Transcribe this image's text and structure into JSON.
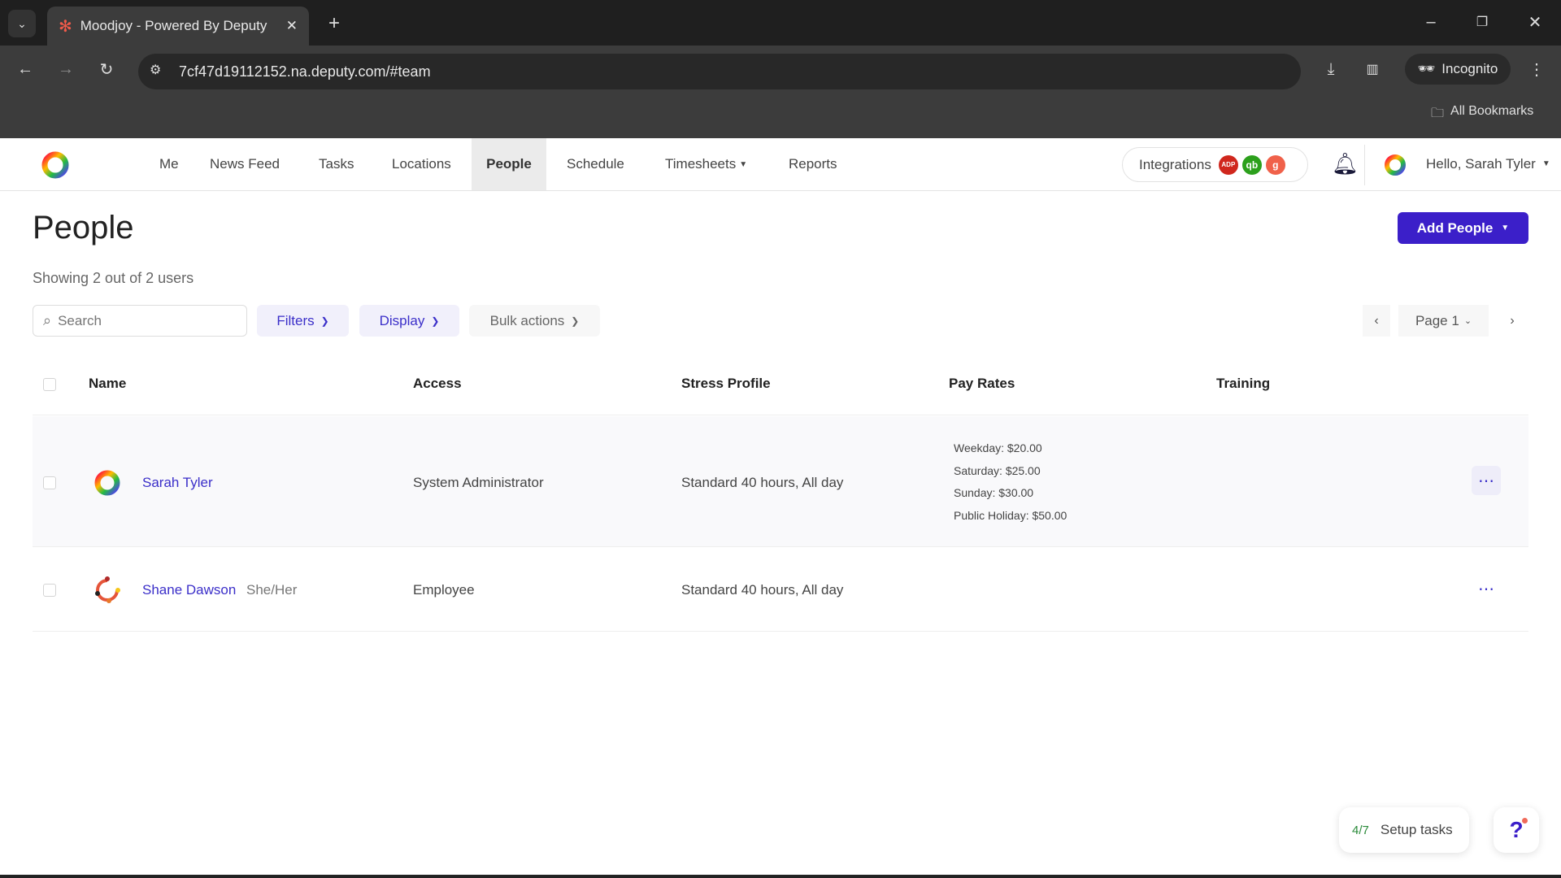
{
  "browser": {
    "tab_title": "Moodjoy - Powered By Deputy",
    "url": "7cf47d19112152.na.deputy.com/#team",
    "incognito_label": "Incognito",
    "bookmarks_label": "All Bookmarks"
  },
  "nav": {
    "items": [
      "Me",
      "News Feed",
      "Tasks",
      "Locations",
      "People",
      "Schedule",
      "Timesheets",
      "Reports"
    ],
    "active": "People",
    "integrations_label": "Integrations",
    "integration_badges": [
      {
        "label": "ADP",
        "color": "#d0271d"
      },
      {
        "label": "qb",
        "color": "#2ca01c"
      },
      {
        "label": "g",
        "color": "#f0614a"
      }
    ],
    "greeting": "Hello, Sarah Tyler"
  },
  "page": {
    "title": "People",
    "subtitle": "Showing 2 out of 2 users",
    "add_button": "Add People",
    "search_placeholder": "Search",
    "filters": "Filters",
    "display": "Display",
    "bulk_actions": "Bulk actions",
    "page_label": "Page 1"
  },
  "table": {
    "headers": [
      "Name",
      "Access",
      "Stress Profile",
      "Pay Rates",
      "Training"
    ],
    "rows": [
      {
        "name": "Sarah Tyler",
        "pronouns": "",
        "access": "System Administrator",
        "stress_profile": "Standard 40 hours, All day",
        "pay_rates": [
          "Weekday: $20.00",
          "Saturday: $25.00",
          "Sunday: $30.00",
          "Public Holiday: $50.00"
        ]
      },
      {
        "name": "Shane Dawson",
        "pronouns": "She/Her",
        "access": "Employee",
        "stress_profile": "Standard 40 hours, All day",
        "pay_rates": []
      }
    ]
  },
  "setup": {
    "progress": "4/7",
    "label": "Setup tasks"
  },
  "help": {
    "label": "?"
  },
  "colors": {
    "accent": "#3b1fc9",
    "nav_active_bg": "#ebebeb"
  }
}
